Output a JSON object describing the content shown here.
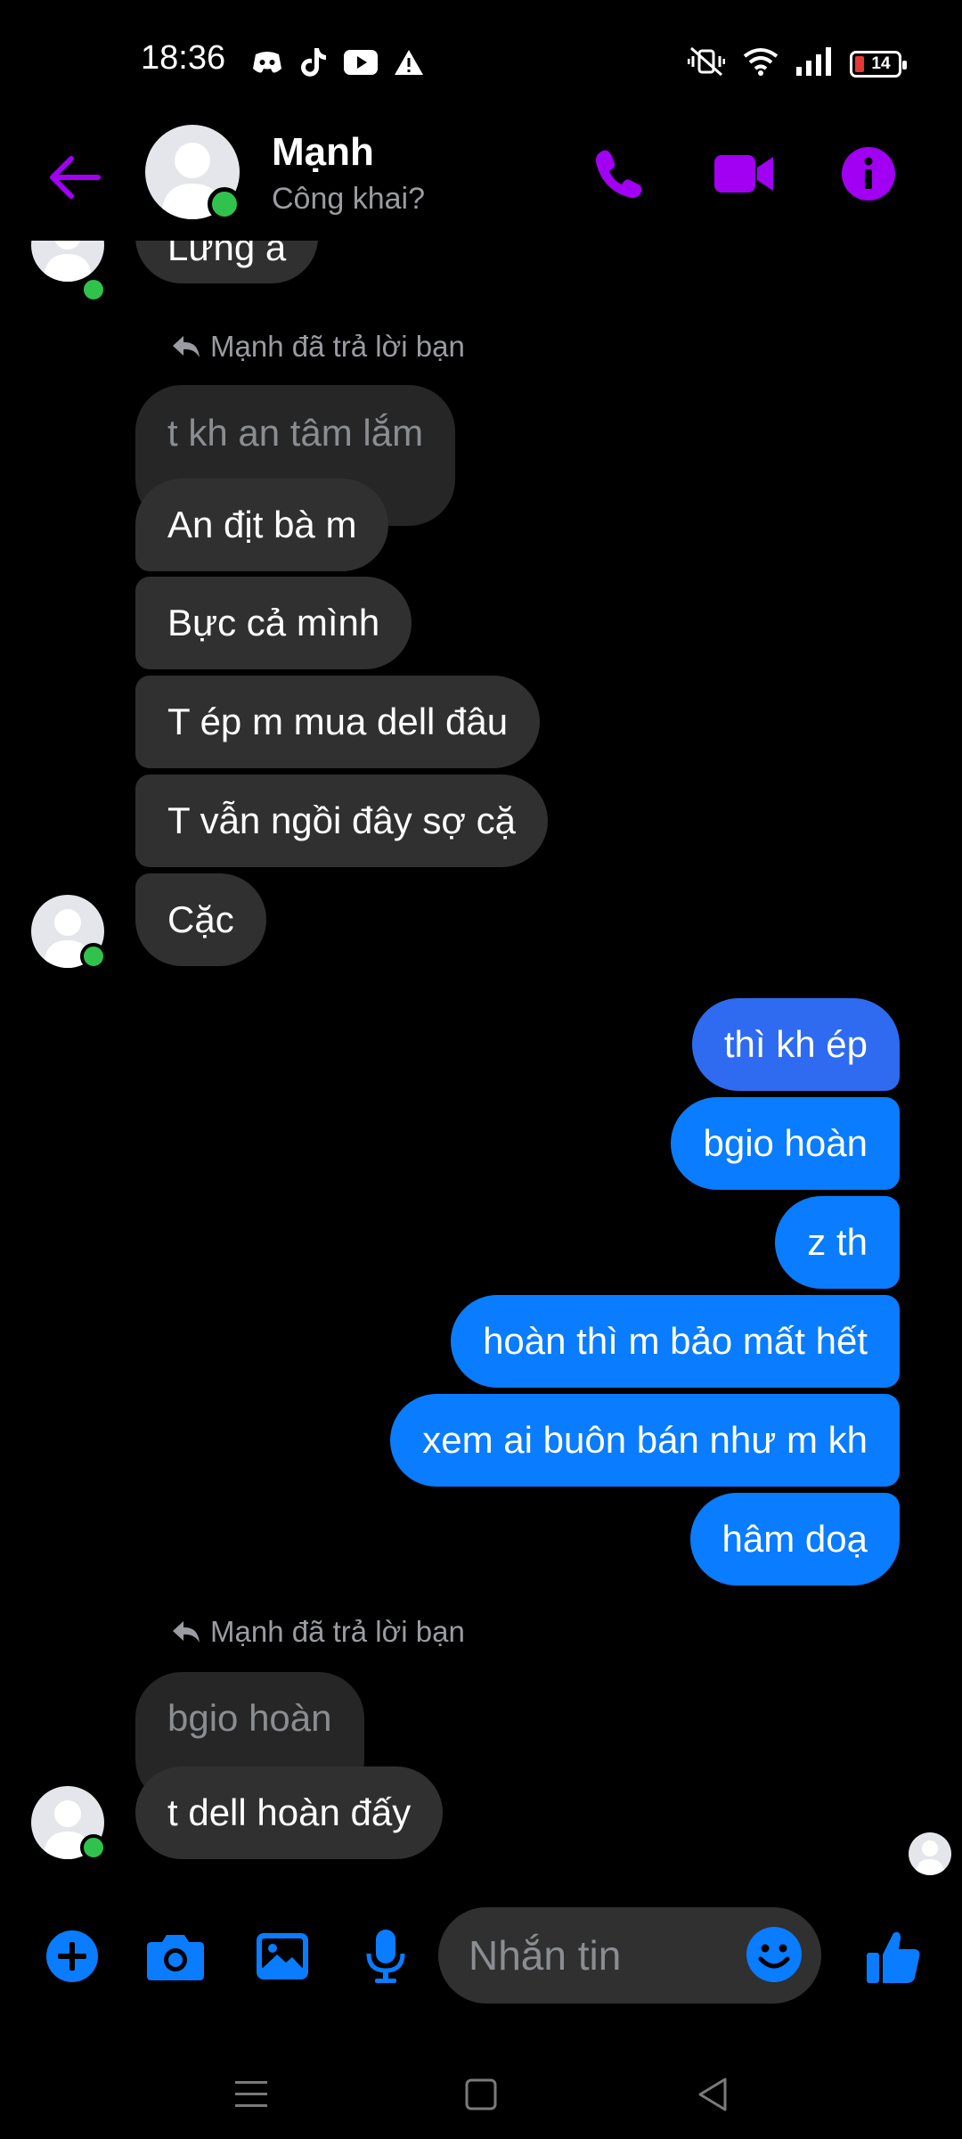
{
  "status_bar": {
    "time": "18:36",
    "battery": "14",
    "left_icons": [
      "discord-icon",
      "tiktok-icon",
      "youtube-icon",
      "warning-icon"
    ],
    "right_icons": [
      "mute-vibrate-icon",
      "wifi-icon",
      "signal-icon",
      "battery-icon"
    ]
  },
  "header": {
    "name": "Mạnh",
    "subtitle": "Công khai?",
    "accent": "#a100f2",
    "icons": [
      "back-arrow-icon",
      "phone-icon",
      "video-icon",
      "info-icon"
    ]
  },
  "messages": {
    "m1": "Lừng à",
    "reply_note_1": "Mạnh đã trả lời bạn",
    "quoted_1": "t kh an tâm lắm",
    "m2": "An địt bà m",
    "m3": "Bực cả mình",
    "m4": "T ép m mua dell đâu",
    "m5": "T vẫn ngồi đây sợ cặ",
    "m6": "Cặc",
    "o1": "thì kh ép",
    "o2": "bgio hoàn",
    "o3": "z th",
    "o4": "hoàn thì m bảo mất hết",
    "o5": "xem ai buôn bán như m kh",
    "o6": "hâm doạ",
    "reply_note_2": "Mạnh đã trả lời bạn",
    "quoted_2": "bgio hoàn",
    "m7": "t dell hoàn đấy"
  },
  "composer": {
    "placeholder": "Nhắn tin",
    "accent": "#0a7cff",
    "icons": [
      "add-icon",
      "camera-icon",
      "gallery-icon",
      "mic-icon",
      "emoji-icon",
      "like-icon"
    ]
  },
  "colors": {
    "incoming_bubble": "#303030",
    "outgoing_bubble": "#0a7cff",
    "online": "#31c24d"
  }
}
